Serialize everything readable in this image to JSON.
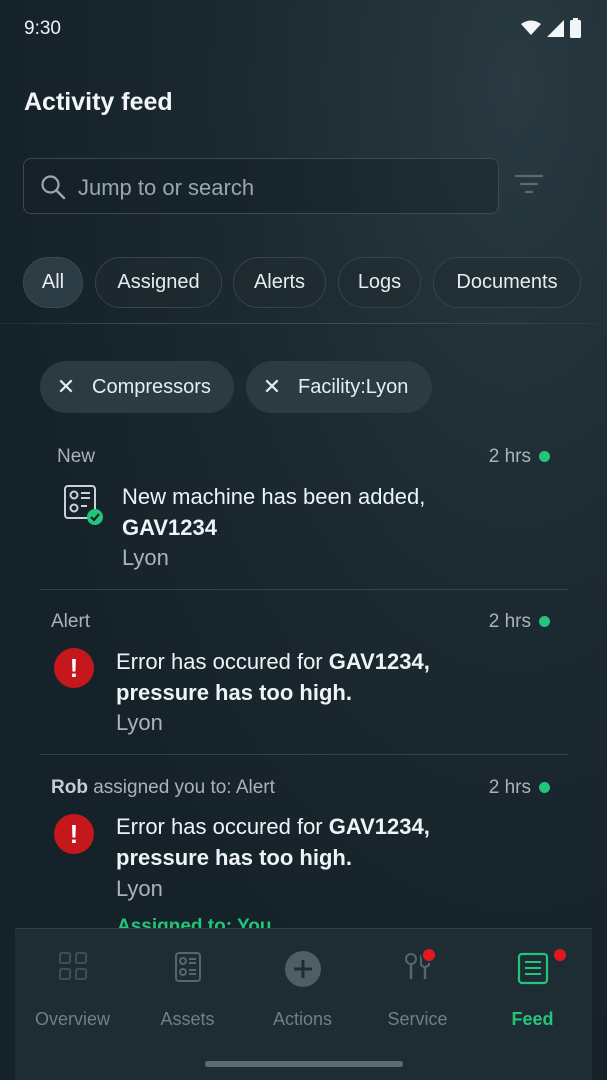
{
  "status_bar": {
    "time": "9:30",
    "icons": [
      "wifi-icon",
      "cellular-icon",
      "battery-icon"
    ]
  },
  "header": {
    "title": "Activity feed"
  },
  "search": {
    "placeholder": "Jump to or search"
  },
  "filter_chips": [
    "All",
    "Assigned",
    "Alerts",
    "Logs",
    "Documents"
  ],
  "active_chip": "All",
  "applied_filters": [
    "Compressors",
    "Facility:Lyon"
  ],
  "feed": [
    {
      "category": "New",
      "time": "2 hrs",
      "icon": "machine-added-icon",
      "text_plain": "New machine has been added,",
      "text_bold": "GAV1234",
      "location": "Lyon"
    },
    {
      "category": "Alert",
      "time": "2 hrs",
      "icon": "alert-icon",
      "text_plain": "Error has occured for ",
      "text_bold": "GAV1234,",
      "text_bold_2": "pressure has too high.",
      "location": "Lyon"
    },
    {
      "assigner": "Rob",
      "category": " assigned you to: Alert",
      "time": "2 hrs",
      "icon": "alert-icon",
      "text_plain": "Error has occured for ",
      "text_bold": "GAV1234,",
      "text_bold_2": "pressure has too high.",
      "location": "Lyon",
      "assigned_to": "Assigned to: You"
    }
  ],
  "bottom_nav": [
    {
      "label": "Overview",
      "icon": "grid-icon",
      "badge": false
    },
    {
      "label": "Assets",
      "icon": "assets-icon",
      "badge": false
    },
    {
      "label": "Actions",
      "icon": "add-circle-icon",
      "badge": false
    },
    {
      "label": "Service",
      "icon": "service-icon",
      "badge": true
    },
    {
      "label": "Feed",
      "icon": "feed-icon",
      "badge": true,
      "active": true
    }
  ],
  "colors": {
    "accent": "#22c57a",
    "alert": "#c4181d",
    "badge": "#e0191f",
    "background": "#17222a"
  }
}
